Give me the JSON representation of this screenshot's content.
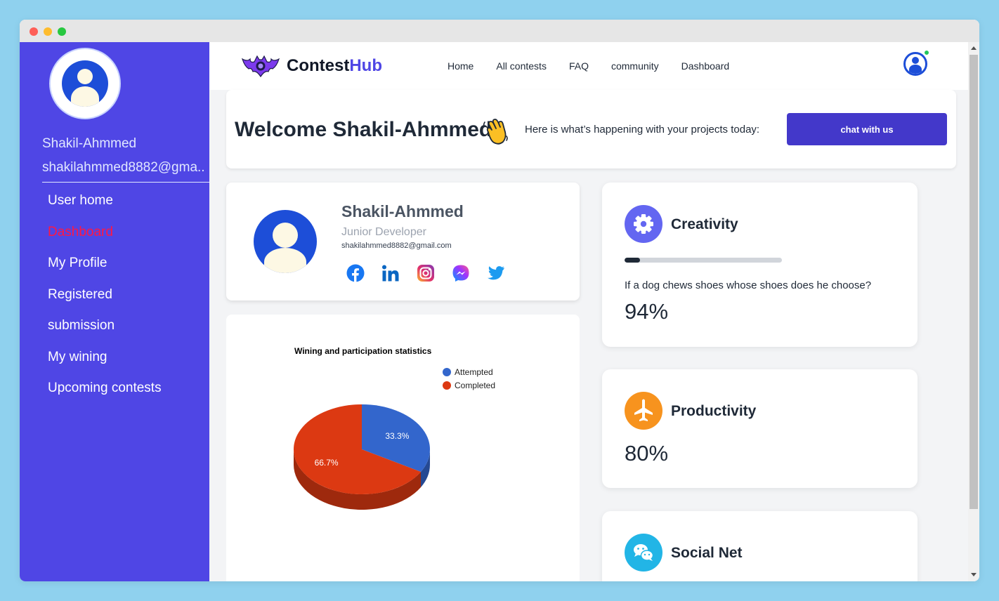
{
  "window": {
    "controls": [
      "close",
      "minimize",
      "maximize"
    ]
  },
  "sidebar": {
    "user_name": "Shakil-Ahmmed",
    "user_email": "shakilahmmed8882@gma..",
    "items": [
      {
        "label": "User home"
      },
      {
        "label": "Dashboard",
        "active": true
      },
      {
        "label": "My Profile"
      },
      {
        "label": "Registered"
      },
      {
        "label": "submission"
      },
      {
        "label": "My wining"
      },
      {
        "label": "Upcoming contests"
      }
    ],
    "active_color": "#ff1744",
    "background": "#4f46e5"
  },
  "navbar": {
    "brand_prefix": "Contest",
    "brand_suffix": "Hub",
    "links": [
      "Home",
      "All contests",
      "FAQ",
      "community",
      "Dashboard"
    ],
    "online_status_color": "#22c55e"
  },
  "welcome": {
    "title": "Welcome Shakil-Ahmmed",
    "emoji": "waving-hand",
    "subtitle": "Here is what’s happening with your projects today:",
    "chat_button": "chat with us"
  },
  "profile": {
    "name": "Shakil-Ahmmed",
    "role": "Junior Developer",
    "email": "shakilahmmed8882@gmail.com",
    "socials": [
      "facebook-icon",
      "linkedin-icon",
      "instagram-icon",
      "messenger-icon",
      "twitter-icon"
    ]
  },
  "chart_data": {
    "type": "pie",
    "title": "Wining and participation statistics",
    "legend_position": "top-right",
    "three_d": true,
    "series": [
      {
        "name": "Attempted",
        "value": 1,
        "label": "33.3%",
        "color": "#3366cc"
      },
      {
        "name": "Completed",
        "value": 2,
        "label": "66.7%",
        "color": "#dc3912"
      }
    ]
  },
  "stats": [
    {
      "title": "Creativity",
      "icon": "gear-icon",
      "icon_color": "#6366f1",
      "progress": 0.1,
      "question": "If a dog chews shoes whose shoes does he choose?",
      "value": "94%"
    },
    {
      "title": "Productivity",
      "icon": "airplane-icon",
      "icon_color": "#f7931e",
      "value": "80%"
    },
    {
      "title": "Social Net",
      "icon": "wechat-icon",
      "icon_color": "#22b5e6"
    }
  ]
}
